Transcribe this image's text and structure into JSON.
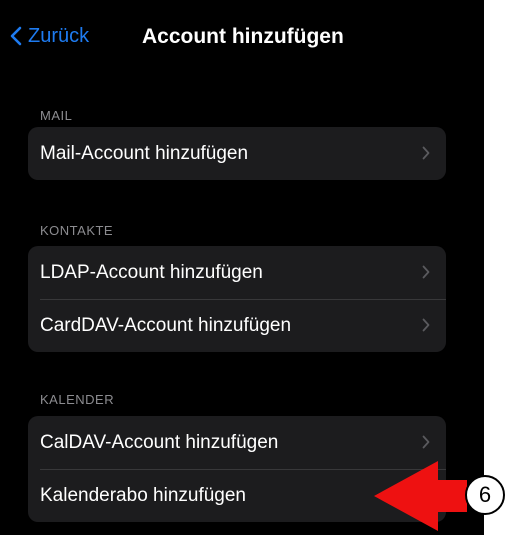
{
  "nav": {
    "back_label": "Zurück",
    "title": "Account hinzufügen"
  },
  "sections": [
    {
      "header": "MAIL",
      "items": [
        {
          "label": "Mail-Account hinzufügen",
          "chevron": true
        }
      ]
    },
    {
      "header": "KONTAKTE",
      "items": [
        {
          "label": "LDAP-Account hinzufügen",
          "chevron": true
        },
        {
          "label": "CardDAV-Account hinzufügen",
          "chevron": true
        }
      ]
    },
    {
      "header": "KALENDER",
      "items": [
        {
          "label": "CalDAV-Account hinzufügen",
          "chevron": true
        },
        {
          "label": "Kalenderabo hinzufügen",
          "chevron": false
        }
      ]
    }
  ],
  "annotation": {
    "step_number": "6",
    "arrow_color": "#ee1111"
  },
  "colors": {
    "background": "#000000",
    "cell": "#1c1c1e",
    "accent": "#1e7bf0",
    "section_header": "#8c8c90",
    "separator": "#38383a"
  }
}
